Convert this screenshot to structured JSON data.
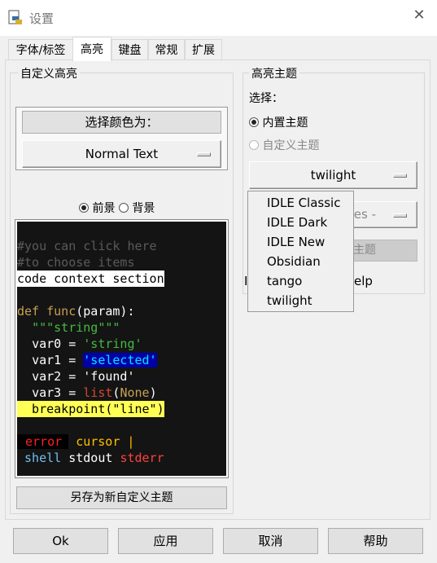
{
  "window": {
    "title": "设置",
    "close": "✕"
  },
  "tabs": [
    {
      "label": "字体/标签"
    },
    {
      "label": "高亮"
    },
    {
      "label": "键盘"
    },
    {
      "label": "常规"
    },
    {
      "label": "扩展"
    }
  ],
  "custom_highlight": {
    "group_label": "自定义高亮",
    "choose_color_button": "选择颜色为：",
    "element_dropdown": "Normal Text",
    "foreground_label": "前景",
    "background_label": "背景",
    "foreground_selected": true,
    "sample": {
      "comment1": "#you can click here",
      "comment2": "#to choose items",
      "context": "code context section",
      "def_kw": "def",
      "func": "func",
      "params": "(param):",
      "docstring": "\"\"\"string\"\"\"",
      "var0": "var0 = ",
      "str0": "'string'",
      "var1": "var1 = ",
      "sel": "'selected'",
      "var2": "var2 = 'found'",
      "var3": "var3 = ",
      "list": "list",
      "paren_open": "(",
      "none": "None",
      "paren_close": ")",
      "breakpoint": "  breakpoint(\"line\")",
      "error": "error",
      "cursor": "cursor |",
      "shell": "shell",
      "stdout": "stdout",
      "stderr": "stderr"
    },
    "save_button": "另存为新自定义主题"
  },
  "highlight_theme": {
    "group_label": "高亮主题",
    "select_label": "选择：",
    "builtin_label": "内置主题",
    "custom_label": "自定义主题",
    "builtin_selected": true,
    "builtin_dropdown": "twilight",
    "custom_dropdown_visible": "mes -",
    "delete_button_visible": "主题",
    "note_visible_start": "I",
    "note_visible_end": "elp",
    "menu_options": [
      "IDLE Classic",
      "IDLE Dark",
      "IDLE New",
      "Obsidian",
      "tango",
      "twilight"
    ]
  },
  "buttons": {
    "ok": "Ok",
    "apply": "应用",
    "cancel": "取消",
    "help": "帮助"
  },
  "colors": {
    "comment": "#5a5a5a",
    "keyword": "#c8a050",
    "string": "#44bb44",
    "selected_bg": "#0000aa",
    "selected_fg": "#00e5ff",
    "builtin": "#d04a30",
    "none": "#c8a050",
    "breakpoint_bg": "#ffff55",
    "error": "#ff2020",
    "cursor": "#ffc000",
    "shell": "#6ec0f0",
    "stderr": "#ff4040"
  }
}
